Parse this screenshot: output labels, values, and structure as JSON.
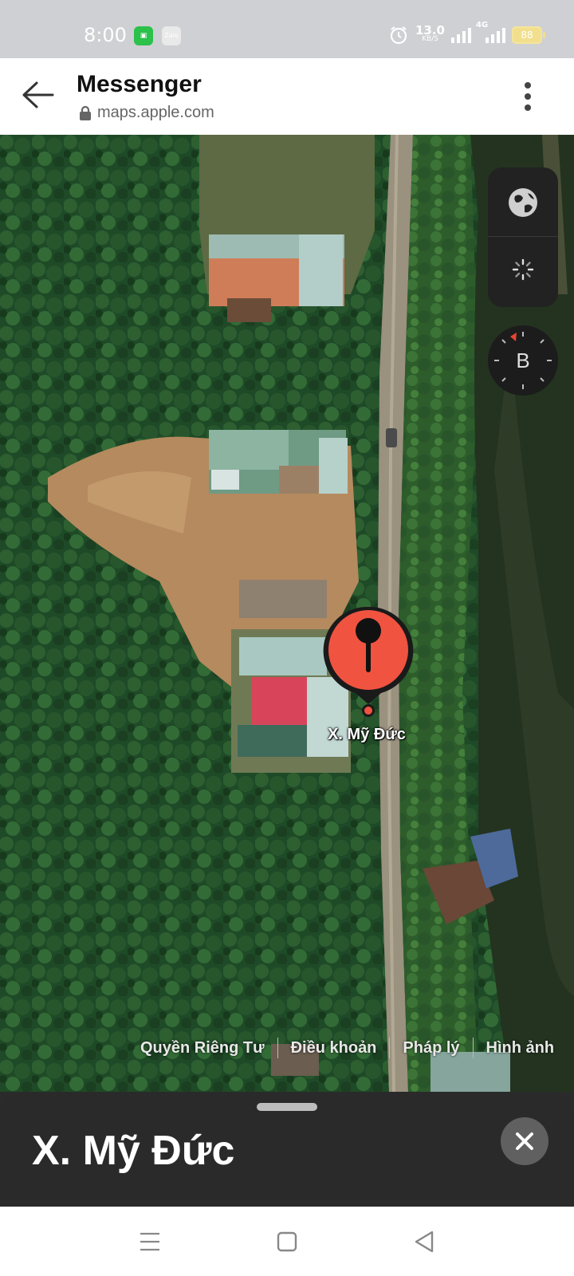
{
  "status_bar": {
    "time": "8:00",
    "apps": [
      {
        "icon": "wechat-app-icon",
        "label": "",
        "color": "#2bc14a"
      },
      {
        "icon": "zalo-app-icon",
        "label": "Zalo",
        "color": "#e9e9ea"
      }
    ],
    "network_speed": "13.0",
    "network_unit": "KB/S",
    "network_type": "4G",
    "battery": "88",
    "colors": {
      "background": "#cfd0d3",
      "battery": "#f1df8e"
    }
  },
  "header": {
    "title": "Messenger",
    "url": "maps.apple.com",
    "icons": {
      "back": "arrow-left-icon",
      "lock": "lock-icon",
      "menu": "more-vertical-icon"
    }
  },
  "map": {
    "type": "satellite",
    "pin_label": "X. Mỹ Đức",
    "pin_color": "#f05340",
    "controls": {
      "globe": "globe-icon",
      "loading": "spinner-icon"
    },
    "compass_label": "B",
    "legal_links": [
      "Quyền Riêng Tư",
      "Điều khoản",
      "Pháp lý",
      "Hình ảnh"
    ]
  },
  "place_sheet": {
    "title": "X. Mỹ Đức",
    "close_icon": "close-icon"
  },
  "nav_bar": {
    "icons": [
      "menu-icon",
      "home-square-icon",
      "back-triangle-icon"
    ]
  }
}
